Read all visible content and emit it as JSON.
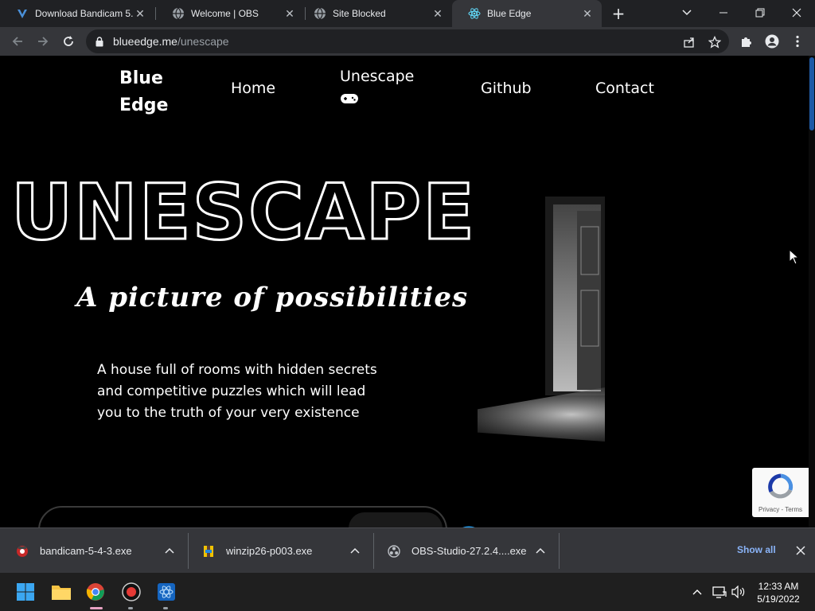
{
  "browser": {
    "tabs": [
      {
        "title": "Download Bandicam 5.",
        "icon": "bandicam-icon",
        "active": false
      },
      {
        "title": "Welcome | OBS",
        "icon": "globe-icon",
        "active": false
      },
      {
        "title": "Site Blocked",
        "icon": "globe-icon",
        "active": false
      },
      {
        "title": "Blue Edge",
        "icon": "react-icon",
        "active": true
      }
    ],
    "url": {
      "host": "blueedge.me",
      "path": "/unescape"
    }
  },
  "site": {
    "brand_line1": "Blue",
    "brand_line2": "Edge",
    "nav": [
      {
        "label": "Home"
      },
      {
        "label": "Unescape"
      },
      {
        "label": "Github"
      },
      {
        "label": "Contact"
      }
    ],
    "hero_title": "UNESCAPE",
    "tagline": "A picture of possibilities",
    "description": "A house full of rooms with hidden secrets and competitive puzzles which will lead you to the truth of your very existence"
  },
  "recaptcha": {
    "text": "Privacy - Terms"
  },
  "downloads": {
    "items": [
      {
        "name": "bandicam-5-4-3.exe",
        "icon": "bandicam-icon"
      },
      {
        "name": "winzip26-p003.exe",
        "icon": "winzip-icon"
      },
      {
        "name": "OBS-Studio-27.2.4....exe",
        "icon": "obs-icon"
      }
    ],
    "show_all": "Show all"
  },
  "taskbar": {
    "time": "12:33 AM",
    "date": "5/19/2022"
  },
  "colors": {
    "accent_blue": "#1c5aa6",
    "link_blue": "#8ab4f8"
  }
}
